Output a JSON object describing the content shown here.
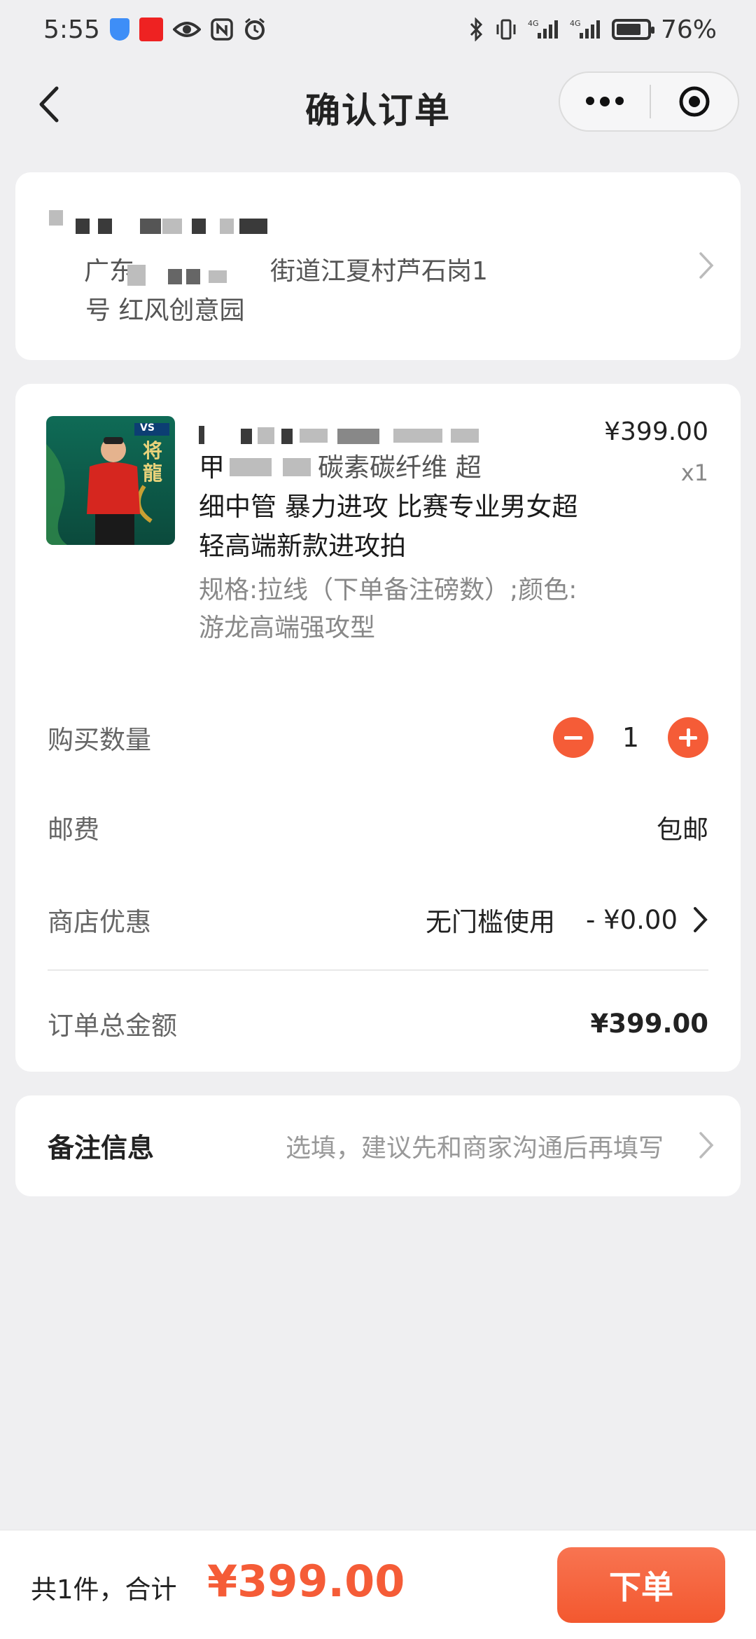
{
  "status_bar": {
    "time": "5:55",
    "battery": "76%"
  },
  "nav": {
    "title": "确认订单"
  },
  "address": {
    "line1": "广东",
    "line1_tail": "街道江夏村芦石岗1",
    "line2": "号 红风创意园"
  },
  "product": {
    "name_line1": "甲",
    "name_line1_tail": "碳素碳纤维 超",
    "name_line2": "细中管 暴力进攻 比赛专业男女超",
    "name_line3": "轻高端新款进攻拍",
    "price": "¥399.00",
    "qty": "x1",
    "spec": "规格:拉线（下单备注磅数）;颜色:游龙高端强攻型",
    "image_logo": "VS",
    "image_text": "将龍"
  },
  "order": {
    "quantity_label": "购买数量",
    "quantity_value": "1",
    "shipping_label": "邮费",
    "shipping_value": "包邮",
    "discount_label": "商店优惠",
    "discount_note": "无门槛使用",
    "discount_value": "- ¥0.00",
    "total_label": "订单总金额",
    "total_value": "¥399.00"
  },
  "note": {
    "label": "备注信息",
    "placeholder": "选填，建议先和商家沟通后再填写"
  },
  "footer": {
    "summary": "共1件，合计",
    "total": "¥399.00",
    "submit": "下单"
  },
  "colors": {
    "accent": "#f55c37",
    "background": "#efeff1"
  }
}
